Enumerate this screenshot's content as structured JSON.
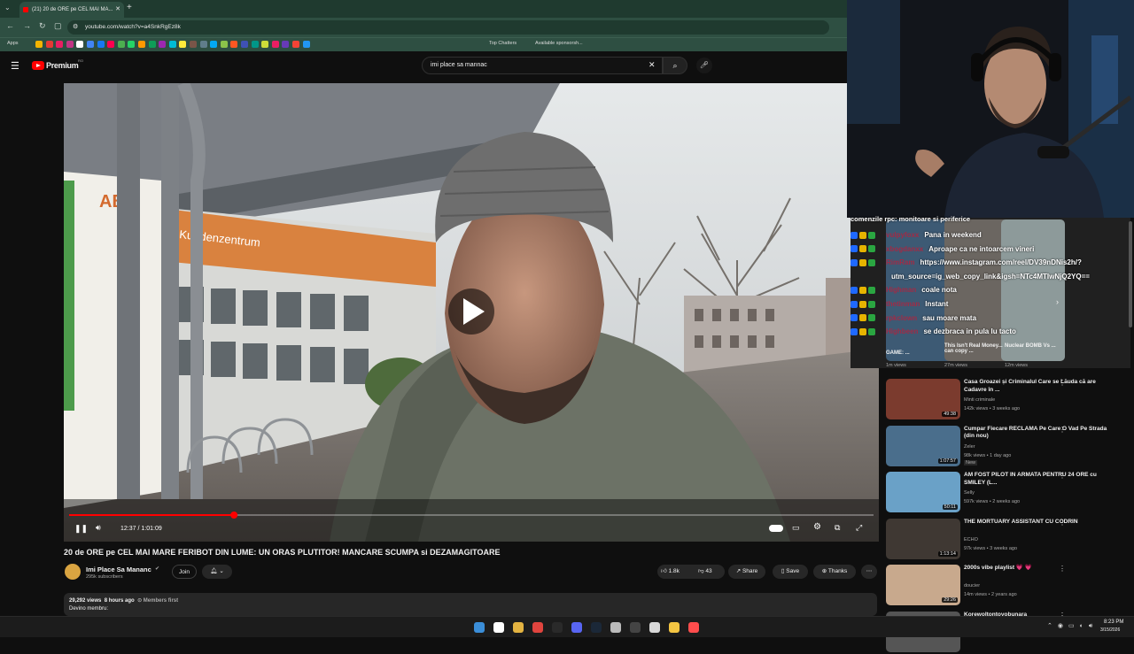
{
  "browser": {
    "tab_title": "(21) 20 de ORE pe CEL MAI MA...",
    "new_tab": "+",
    "url": "youtube.com/watch?v=a4SnkRgEz8k",
    "bookmarks": [
      "Apps",
      "Top Chatters",
      "Available sponsorsh..."
    ]
  },
  "youtube": {
    "logo_label": "Premium",
    "logo_sup": "RO",
    "search_query": "imi place sa mannac",
    "clear_icon": "close-icon",
    "search_icon": "search-icon",
    "mic_icon": "mic-icon"
  },
  "player": {
    "time_current": "12:37",
    "time_total": "1:01:09",
    "time_sep": " / ",
    "progress": 0.205
  },
  "video": {
    "title": "20 de ORE pe CEL MAI MARE FERIBOT DIN LUME: UN ORAS PLUTITOR! MANCARE SCUMPA si DEZAMAGITOARE",
    "channel": "Imi Place Sa Mananc",
    "subscribers": "295k subscribers",
    "join_label": "Join",
    "likes": "1.8k",
    "dislikes": "43",
    "share_label": "Share",
    "save_label": "Save",
    "thanks_label": "Thanks",
    "views": "29,292 views",
    "age": "8 hours ago",
    "members_first": "Members first",
    "desc_line": "Devino membru:"
  },
  "chat": {
    "top_partial": "comenzile rpc: monitoare si periferice",
    "messages": [
      {
        "user": "vulpyfoxx",
        "text": "Pana in weekend"
      },
      {
        "user": "xbogdanxx",
        "text": "Aproape ca ne intoarcem vineri"
      },
      {
        "user": "RimRam",
        "text": "https://www.instagram.com/reel/DV39nDNis2h/?"
      },
      {
        "user": "",
        "text": "utm_source=ig_web_copy_link&igsh=NTc4MTIwNjQ2YQ=="
      },
      {
        "user": "Highman",
        "text": "coale nota"
      },
      {
        "user": "thetinman",
        "text": "Instant"
      },
      {
        "user": "rpkclown",
        "text": "sau moare mata"
      },
      {
        "user": "Highbeen",
        "text": "se dezbraca in pula lu tacto"
      }
    ]
  },
  "shelf": [
    {
      "title": "GAME: ...",
      "views": "1m views"
    },
    {
      "title": "This Isn't Real Money... can copy ...",
      "views": "27m views"
    },
    {
      "title": "Nuclear BOMB Vs ...",
      "views": "12m views"
    }
  ],
  "recommendations": [
    {
      "title": "Casa Groazei și Criminalul Care se Lăuda că are Cadavre în ...",
      "channel": "Minti criminale",
      "meta": "142k views • 3 weeks ago",
      "duration": "49:38",
      "badge": ""
    },
    {
      "title": "Cumpar Fiecare RECLAMA Pe Care O Vad Pe Strada (din nou)",
      "channel": "Zeler",
      "meta": "98k views • 1 day ago",
      "duration": "1:07:57",
      "badge": "New"
    },
    {
      "title": "AM FOST PILOT IN ARMATA PENTRU 24 ORE cu SMILEY (L...",
      "channel": "Selly",
      "meta": "597k views • 2 weeks ago",
      "duration": "50:11",
      "badge": ""
    },
    {
      "title": "THE MORTUARY ASSISTANT CU CODRIN",
      "channel": "ECHO",
      "meta": "97k views • 3 weeks ago",
      "duration": "1:13:14",
      "badge": ""
    },
    {
      "title": "2000s vibe playlist 💗 💗",
      "channel": "doucier",
      "meta": "14m views • 2 years ago",
      "duration": "29:26",
      "badge": ""
    },
    {
      "title": "Korewoltontoyobunara",
      "channel": "",
      "meta": "",
      "duration": "",
      "badge": ""
    }
  ],
  "taskbar": {
    "time": "8:23 PM",
    "date": "3/15/2026"
  },
  "colors": {
    "accent": "#ff0000",
    "chat_user": "#a02b46",
    "browser_chrome": "#2e4f42"
  }
}
